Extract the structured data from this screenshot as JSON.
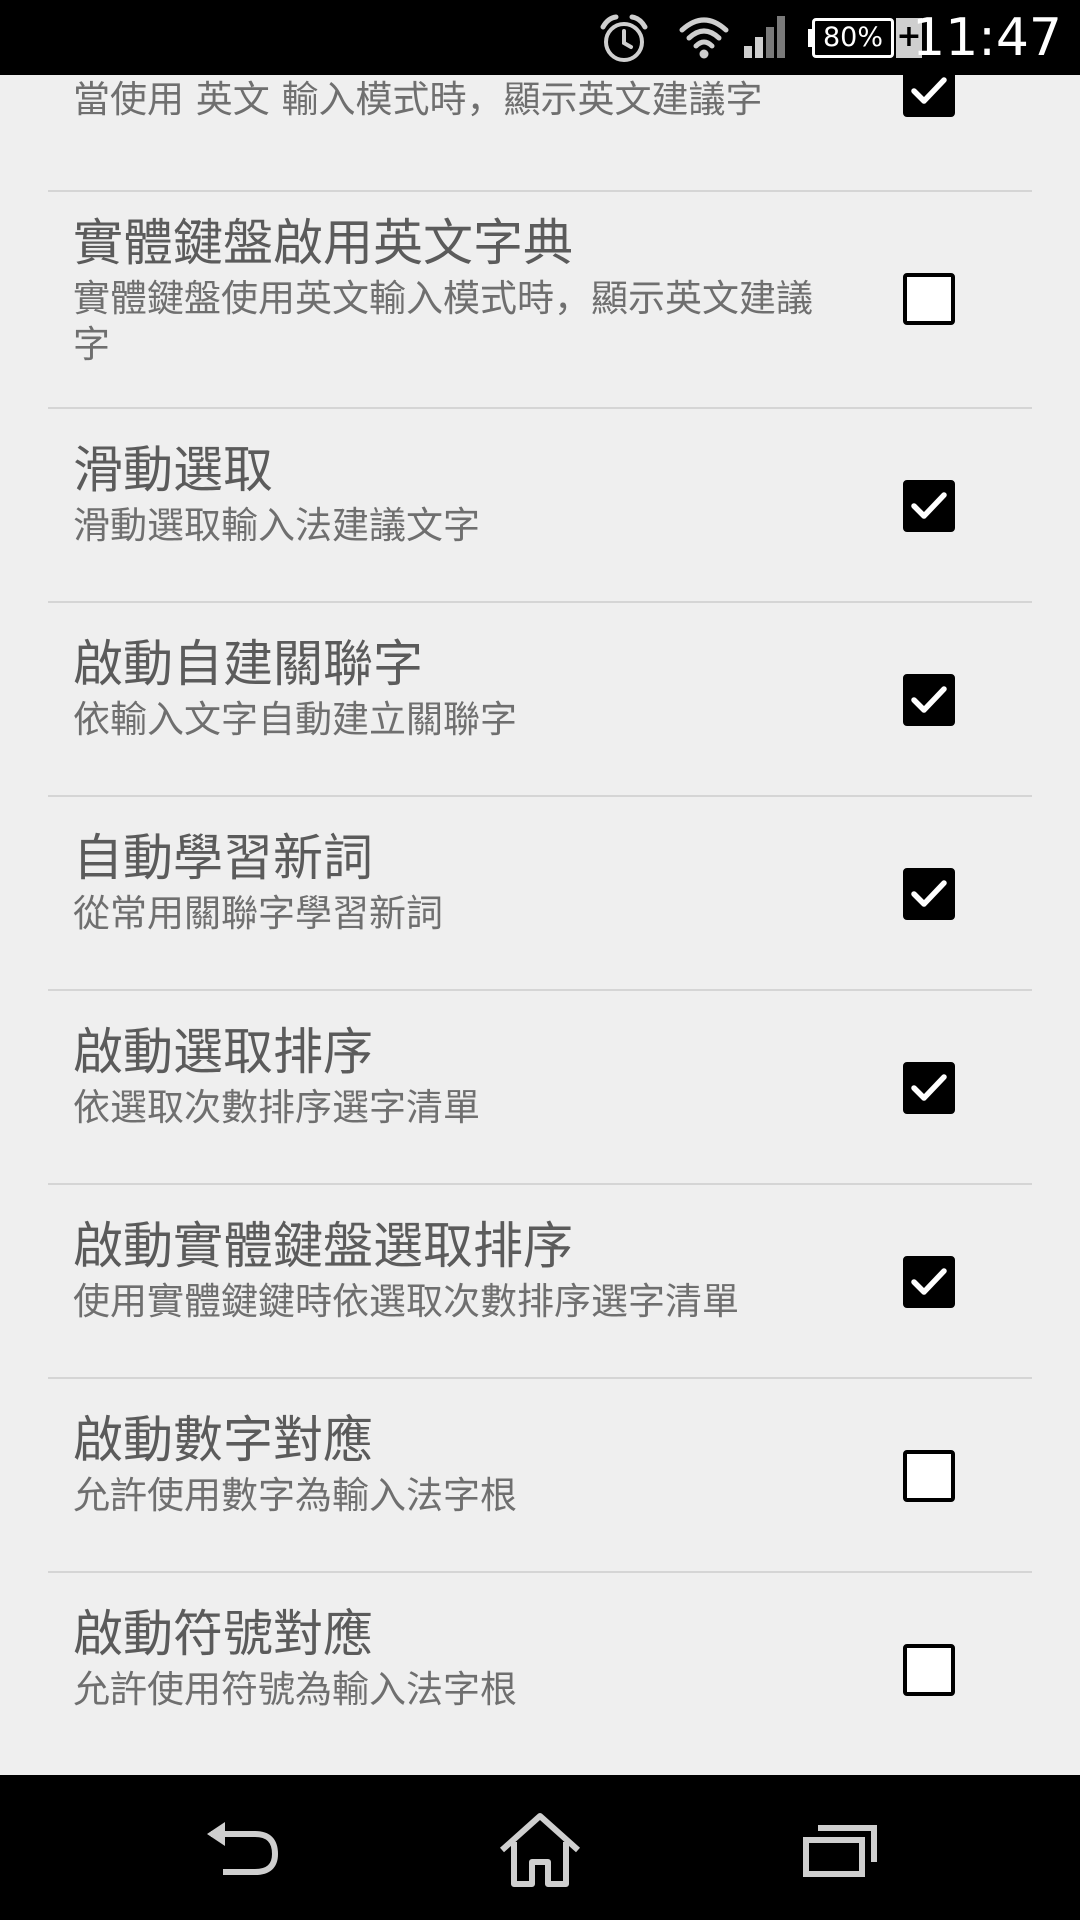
{
  "status_bar": {
    "battery_percent": "80%",
    "charging_symbol": "+",
    "time": "11:47",
    "icons": [
      "alarm-icon",
      "wifi-icon",
      "cell-signal-icon",
      "battery-icon"
    ]
  },
  "settings": [
    {
      "title": "",
      "summary": "當使用 英文 輸入模式時，顯示英文建議字",
      "checked": true
    },
    {
      "title": "實體鍵盤啟用英文字典",
      "summary": "實體鍵盤使用英文輸入模式時，顯示英文建議字",
      "checked": false
    },
    {
      "title": "滑動選取",
      "summary": "滑動選取輸入法建議文字",
      "checked": true
    },
    {
      "title": "啟動自建關聯字",
      "summary": "依輸入文字自動建立關聯字",
      "checked": true
    },
    {
      "title": "自動學習新詞",
      "summary": "從常用關聯字學習新詞",
      "checked": true
    },
    {
      "title": "啟動選取排序",
      "summary": "依選取次數排序選字清單",
      "checked": true
    },
    {
      "title": "啟動實體鍵盤選取排序",
      "summary": "使用實體鍵鍵時依選取次數排序選字清單",
      "checked": true
    },
    {
      "title": "啟動數字對應",
      "summary": "允許使用數字為輸入法字根",
      "checked": false
    },
    {
      "title": "啟動符號對應",
      "summary": "允許使用符號為輸入法字根",
      "checked": false
    }
  ],
  "nav_bar": {
    "icons": [
      "back-icon",
      "home-icon",
      "recent-apps-icon"
    ]
  }
}
